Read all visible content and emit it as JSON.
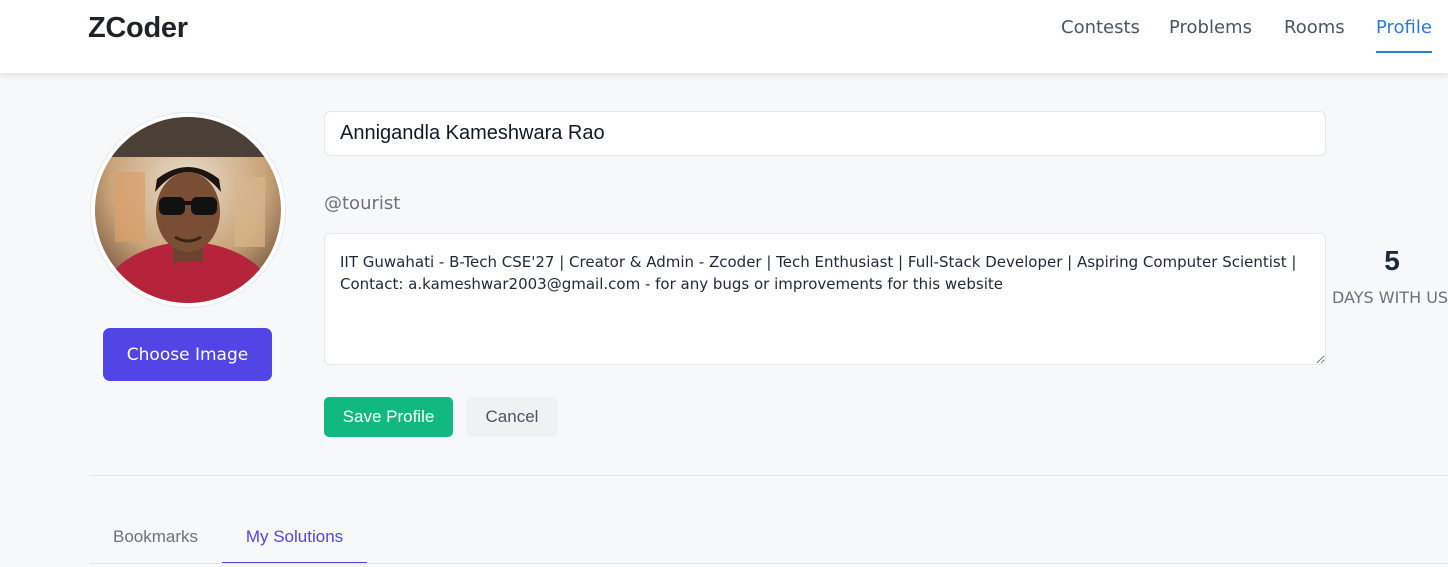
{
  "header": {
    "logo": "ZCoder",
    "nav": [
      {
        "label": "Contests",
        "active": false
      },
      {
        "label": "Problems",
        "active": false
      },
      {
        "label": "Rooms",
        "active": false
      },
      {
        "label": "Profile",
        "active": true
      }
    ]
  },
  "profile": {
    "choose_image_label": "Choose Image",
    "name_value": "Annigandla Kameshwara Rao",
    "handle": "@tourist",
    "bio_value": "IIT Guwahati - B-Tech CSE'27 | Creator & Admin - Zcoder | Tech Enthusiast | Full-Stack Developer | Aspiring Computer Scientist | Contact: a.kameshwar2003@gmail.com - for any bugs or improvements for this website",
    "save_label": "Save Profile",
    "cancel_label": "Cancel"
  },
  "stats": {
    "days_value": "5",
    "days_label": "DAYS WITH US"
  },
  "tabs": [
    {
      "label": "Bookmarks",
      "active": false
    },
    {
      "label": "My Solutions",
      "active": true
    }
  ],
  "colors": {
    "primary": "#5145e5",
    "success": "#11b981",
    "link_active": "#2f7ad1"
  }
}
